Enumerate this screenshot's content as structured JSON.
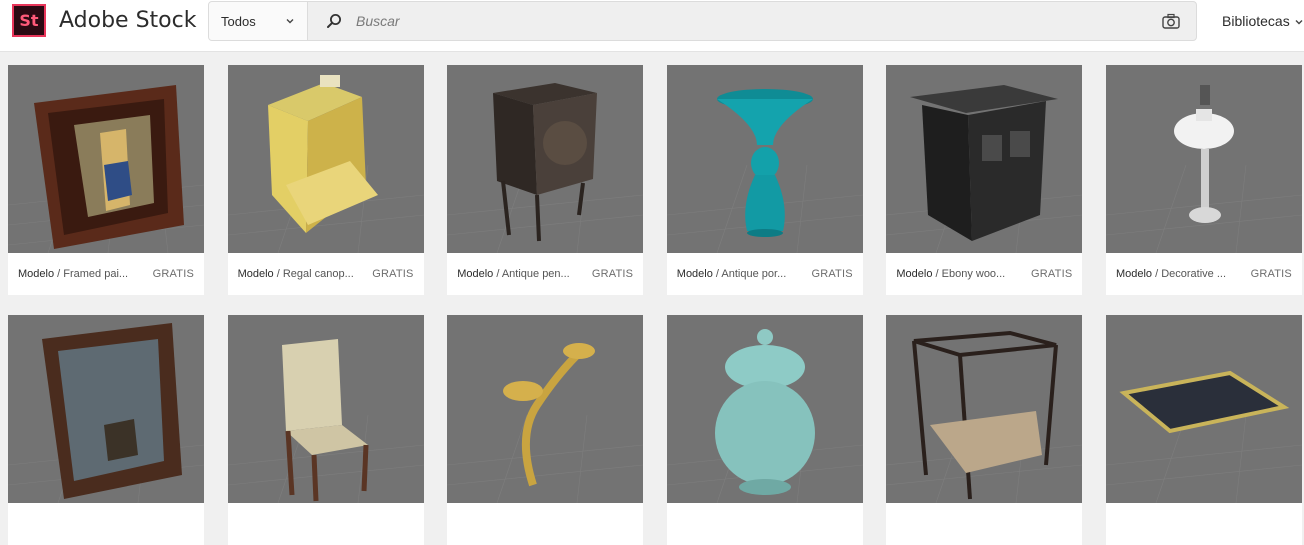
{
  "header": {
    "logo_text": "St",
    "brand": "Adobe Stock",
    "filter_label": "Todos",
    "search_placeholder": "Buscar",
    "libraries_label": "Bibliotecas"
  },
  "icons": [
    "logo-icon",
    "chevron-down-icon",
    "search-icon",
    "camera-icon"
  ],
  "colors": {
    "accent": "#e8355a",
    "logo_bg": "#2b0a13",
    "thumb_bg": "#727272"
  },
  "results": [
    {
      "type": "Modelo",
      "title": "Framed pai...",
      "price": "GRATIS",
      "icon": "framed-painting-thumbnail"
    },
    {
      "type": "Modelo",
      "title": "Regal canop...",
      "price": "GRATIS",
      "icon": "canopy-bed-thumbnail"
    },
    {
      "type": "Modelo",
      "title": "Antique pen...",
      "price": "GRATIS",
      "icon": "pendulum-clock-thumbnail"
    },
    {
      "type": "Modelo",
      "title": "Antique por...",
      "price": "GRATIS",
      "icon": "porcelain-vase-thumbnail"
    },
    {
      "type": "Modelo",
      "title": "Ebony woo...",
      "price": "GRATIS",
      "icon": "ebony-cabinet-thumbnail"
    },
    {
      "type": "Modelo",
      "title": "Decorative ...",
      "price": "GRATIS",
      "icon": "oil-lamp-thumbnail"
    },
    {
      "type": "",
      "title": "",
      "price": "",
      "icon": "ship-painting-thumbnail"
    },
    {
      "type": "",
      "title": "",
      "price": "",
      "icon": "armchair-thumbnail"
    },
    {
      "type": "",
      "title": "",
      "price": "",
      "icon": "candle-sconce-thumbnail"
    },
    {
      "type": "",
      "title": "",
      "price": "",
      "icon": "ginger-jar-thumbnail"
    },
    {
      "type": "",
      "title": "",
      "price": "",
      "icon": "crib-thumbnail"
    },
    {
      "type": "",
      "title": "",
      "price": "",
      "icon": "rug-thumbnail"
    }
  ]
}
